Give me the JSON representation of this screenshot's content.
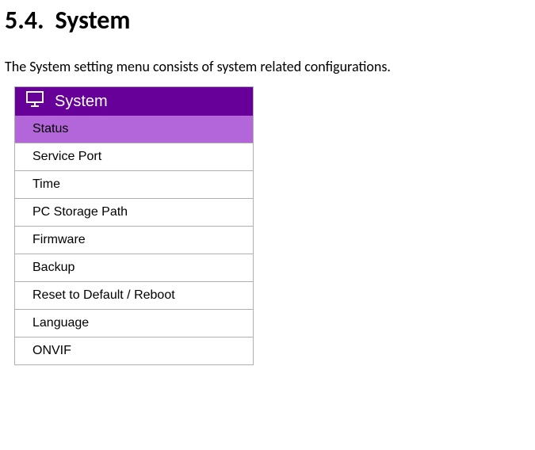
{
  "heading": {
    "number": "5.4.",
    "title": "System"
  },
  "description": "The System setting menu consists of system related configurations.",
  "menu": {
    "title": "System",
    "items": [
      {
        "label": "Status",
        "active": true
      },
      {
        "label": "Service Port",
        "active": false
      },
      {
        "label": "Time",
        "active": false
      },
      {
        "label": "PC Storage Path",
        "active": false
      },
      {
        "label": "Firmware",
        "active": false
      },
      {
        "label": "Backup",
        "active": false
      },
      {
        "label": "Reset to Default / Reboot",
        "active": false
      },
      {
        "label": "Language",
        "active": false
      },
      {
        "label": "ONVIF",
        "active": false
      }
    ]
  }
}
